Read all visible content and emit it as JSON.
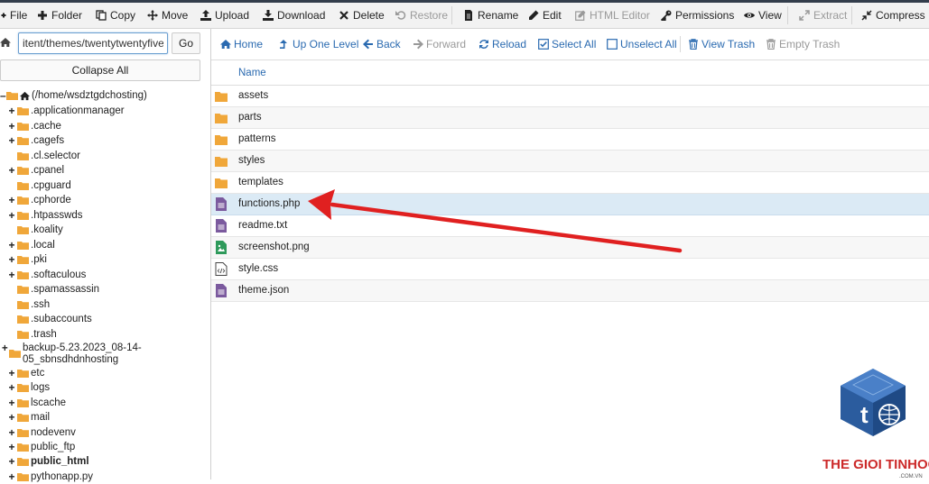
{
  "toolbar": {
    "file": "File",
    "folder": "Folder",
    "copy": "Copy",
    "move": "Move",
    "upload": "Upload",
    "download": "Download",
    "delete": "Delete",
    "restore": "Restore",
    "rename": "Rename",
    "edit": "Edit",
    "html_editor": "HTML Editor",
    "permissions": "Permissions",
    "view": "View",
    "extract": "Extract",
    "compress": "Compress"
  },
  "path_bar": {
    "value": "itent/themes/twentytwentyfive",
    "go_label": "Go",
    "collapse_label": "Collapse All"
  },
  "tree": {
    "root_label": "(/home/wsdztgdchosting)",
    "items": [
      {
        "label": ".applicationmanager",
        "expandable": true
      },
      {
        "label": ".cache",
        "expandable": true
      },
      {
        "label": ".cagefs",
        "expandable": true
      },
      {
        "label": ".cl.selector",
        "expandable": false
      },
      {
        "label": ".cpanel",
        "expandable": true
      },
      {
        "label": ".cpguard",
        "expandable": false
      },
      {
        "label": ".cphorde",
        "expandable": true
      },
      {
        "label": ".htpasswds",
        "expandable": true
      },
      {
        "label": ".koality",
        "expandable": false
      },
      {
        "label": ".local",
        "expandable": true
      },
      {
        "label": ".pki",
        "expandable": true
      },
      {
        "label": ".softaculous",
        "expandable": true
      },
      {
        "label": ".spamassassin",
        "expandable": false
      },
      {
        "label": ".ssh",
        "expandable": false
      },
      {
        "label": ".subaccounts",
        "expandable": false
      },
      {
        "label": ".trash",
        "expandable": false
      }
    ],
    "backup_line1": "backup-5.23.2023_08-14-",
    "backup_line2": "05_sbnsdhdnhosting",
    "items2": [
      {
        "label": "etc",
        "expandable": true,
        "bold": false
      },
      {
        "label": "logs",
        "expandable": true,
        "bold": false
      },
      {
        "label": "lscache",
        "expandable": true,
        "bold": false
      },
      {
        "label": "mail",
        "expandable": true,
        "bold": false
      },
      {
        "label": "nodevenv",
        "expandable": true,
        "bold": false
      },
      {
        "label": "public_ftp",
        "expandable": true,
        "bold": false
      },
      {
        "label": "public_html",
        "expandable": true,
        "bold": true
      },
      {
        "label": "pythonapp.py",
        "expandable": true,
        "bold": false
      }
    ]
  },
  "nav": {
    "home": "Home",
    "up": "Up One Level",
    "back": "Back",
    "forward": "Forward",
    "reload": "Reload",
    "select_all": "Select All",
    "unselect_all": "Unselect All",
    "view_trash": "View Trash",
    "empty_trash": "Empty Trash"
  },
  "table": {
    "header_name": "Name",
    "rows": [
      {
        "name": "assets",
        "icon": "folder-icon"
      },
      {
        "name": "parts",
        "icon": "folder-icon"
      },
      {
        "name": "patterns",
        "icon": "folder-icon"
      },
      {
        "name": "styles",
        "icon": "folder-icon"
      },
      {
        "name": "templates",
        "icon": "folder-icon"
      },
      {
        "name": "functions.php",
        "icon": "php-file-icon",
        "selected": true
      },
      {
        "name": "readme.txt",
        "icon": "text-file-icon"
      },
      {
        "name": "screenshot.png",
        "icon": "image-file-icon"
      },
      {
        "name": "style.css",
        "icon": "code-file-icon"
      },
      {
        "name": "theme.json",
        "icon": "text-file-icon"
      }
    ]
  },
  "watermark": {
    "brand": "THE GIOI TINHOC",
    "sub": ".COM.VN"
  },
  "colors": {
    "accent": "#2a6ab0",
    "folder": "#f0a73a",
    "selected_row": "#dbeaf5",
    "arrow": "#e02020"
  }
}
